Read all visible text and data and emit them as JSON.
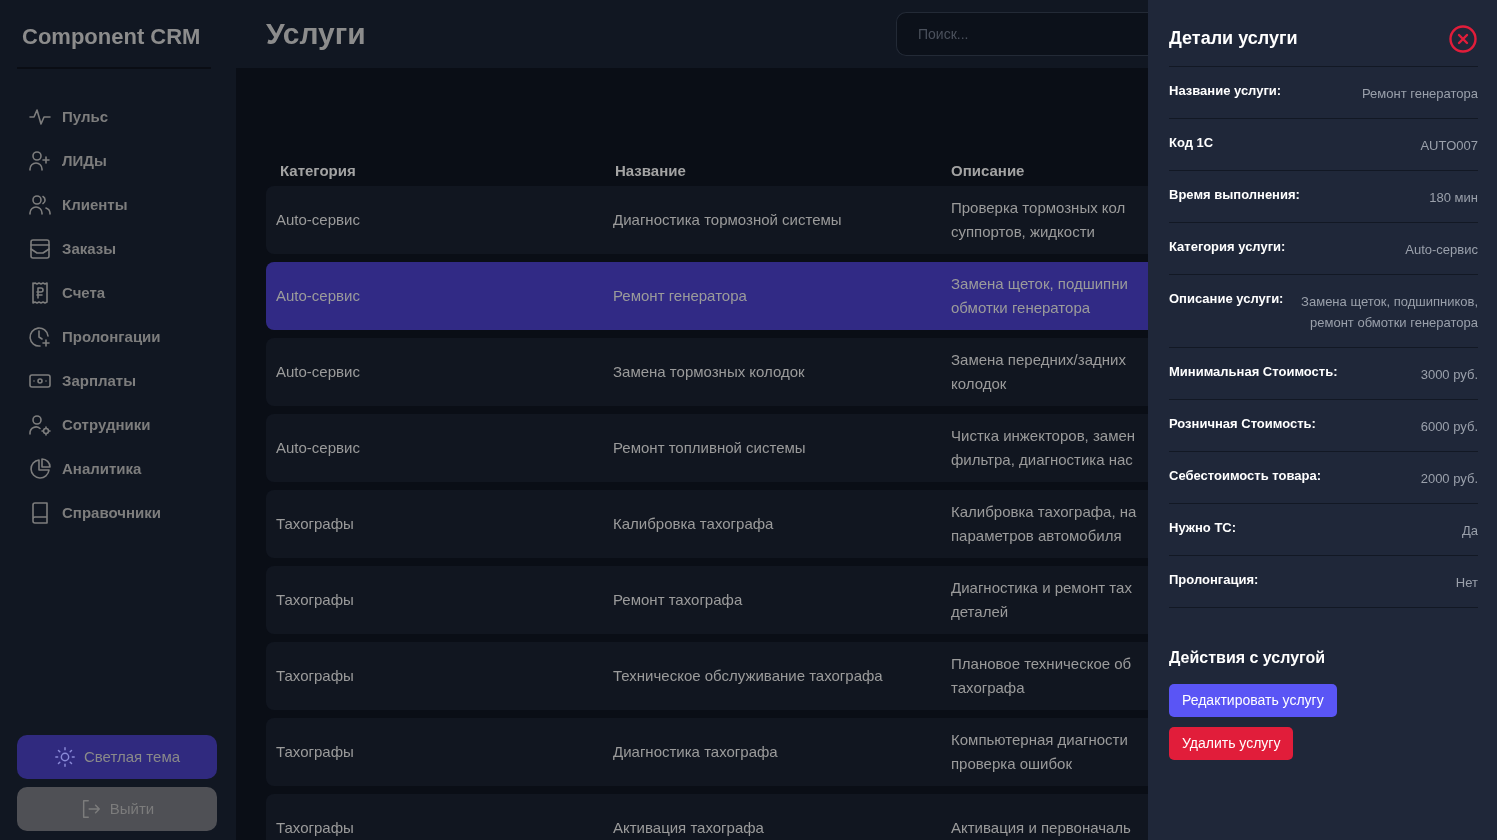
{
  "sidebar": {
    "logo": "Component CRM",
    "items": [
      {
        "label": "Пульс",
        "kind": "pulse"
      },
      {
        "label": "ЛИДы",
        "kind": "userplus"
      },
      {
        "label": "Клиенты",
        "kind": "users"
      },
      {
        "label": "Заказы",
        "kind": "inbox"
      },
      {
        "label": "Счета",
        "kind": "receipt"
      },
      {
        "label": "Пролонгации",
        "kind": "clock"
      },
      {
        "label": "Зарплаты",
        "kind": "cash"
      },
      {
        "label": "Сотрудники",
        "kind": "usergear"
      },
      {
        "label": "Аналитика",
        "kind": "pie"
      },
      {
        "label": "Справочники",
        "kind": "book"
      }
    ],
    "theme_button": "Светлая тема",
    "logout_button": "Выйти"
  },
  "header": {
    "title": "Услуги",
    "search": {
      "placeholder": "Поиск..."
    }
  },
  "table": {
    "columns": [
      "Категория",
      "Название",
      "Описание"
    ],
    "rows": [
      {
        "category": "Auto-сервис",
        "name": "Диагностика тормозной системы",
        "description": "Проверка тормозных кол\nсуппортов, жидкости",
        "selected": false
      },
      {
        "category": "Auto-сервис",
        "name": "Ремонт генератора",
        "description": "Замена щеток, подшипни\nобмотки генератора",
        "selected": true
      },
      {
        "category": "Auto-сервис",
        "name": "Замена тормозных колодок",
        "description": "Замена передних/задних\nколодок",
        "selected": false
      },
      {
        "category": "Auto-сервис",
        "name": "Ремонт топливной системы",
        "description": "Чистка инжекторов, замен\nфильтра, диагностика нас",
        "selected": false
      },
      {
        "category": "Тахографы",
        "name": "Калибровка тахографа",
        "description": "Калибровка тахографа, на\nпараметров автомобиля",
        "selected": false
      },
      {
        "category": "Тахографы",
        "name": "Ремонт тахографа",
        "description": "Диагностика и ремонт тах\nдеталей",
        "selected": false
      },
      {
        "category": "Тахографы",
        "name": "Техническое обслуживание тахографа",
        "description": "Плановое техническое об\nтахографа",
        "selected": false
      },
      {
        "category": "Тахографы",
        "name": "Диагностика тахографа",
        "description": "Компьютерная диагности\nпроверка ошибок",
        "selected": false
      },
      {
        "category": "Тахографы",
        "name": "Активация тахографа",
        "description": "Активация и первоначаль",
        "selected": false
      }
    ]
  },
  "details": {
    "title": "Детали услуги",
    "fields": [
      {
        "label": "Название услуги:",
        "value": "Ремонт генератора"
      },
      {
        "label": "Код 1С",
        "value": "AUTO007"
      },
      {
        "label": "Время выполнения:",
        "value": "180 мин"
      },
      {
        "label": "Категория услуги:",
        "value": "Auto-сервис"
      },
      {
        "label": "Описание услуги:",
        "value": "Замена щеток, подшипников, ремонт обмотки генератора"
      },
      {
        "label": "Минимальная Стоимость:",
        "value": "3000 руб."
      },
      {
        "label": "Розничная Стоимость:",
        "value": "6000 руб."
      },
      {
        "label": "Себестоимость товара:",
        "value": "2000 руб."
      },
      {
        "label": "Нужно ТС:",
        "value": "Да"
      },
      {
        "label": "Пролонгация:",
        "value": "Нет"
      }
    ],
    "actions_title": "Действия с услугой",
    "actions": [
      {
        "label": "Редактировать услугу",
        "kind": "edit"
      },
      {
        "label": "Удалить услугу",
        "kind": "delete"
      }
    ]
  }
}
